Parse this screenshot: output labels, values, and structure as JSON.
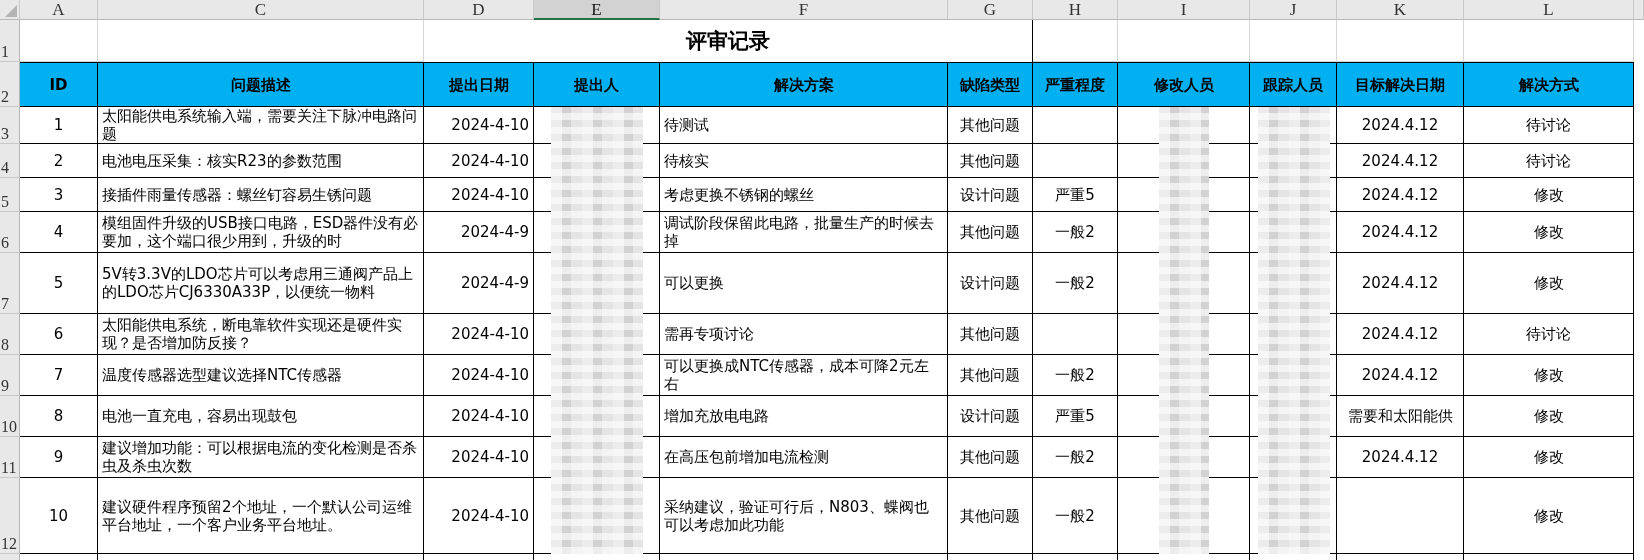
{
  "columns": [
    {
      "letter": "A",
      "selected": false
    },
    {
      "letter": "C",
      "selected": false
    },
    {
      "letter": "D",
      "selected": false
    },
    {
      "letter": "E",
      "selected": true
    },
    {
      "letter": "F",
      "selected": false
    },
    {
      "letter": "G",
      "selected": false
    },
    {
      "letter": "H",
      "selected": false
    },
    {
      "letter": "I",
      "selected": false
    },
    {
      "letter": "J",
      "selected": false
    },
    {
      "letter": "K",
      "selected": false
    },
    {
      "letter": "L",
      "selected": false
    }
  ],
  "row_numbers": [
    "1",
    "2",
    "3",
    "4",
    "5",
    "6",
    "7",
    "8",
    "9",
    "10",
    "11",
    "12"
  ],
  "title": "评审记录",
  "headers": [
    "ID",
    "问题描述",
    "提出日期",
    "提出人",
    "解决方案",
    "缺陷类型",
    "严重程度",
    "修改人员",
    "跟踪人员",
    "目标解决日期",
    "解决方式"
  ],
  "rows": [
    {
      "id": "1",
      "description": "太阳能供电系统输入端，需要关注下脉冲电路问题",
      "date": "2024-4-10",
      "solution": "待测试",
      "defect_type": "其他问题",
      "target_date": "2024.4.12",
      "resolution": "待讨论"
    },
    {
      "id": "2",
      "description": "电池电压采集：核实R23的参数范围",
      "date": "2024-4-10",
      "solution": "待核实",
      "defect_type": "其他问题",
      "target_date": "2024.4.12",
      "resolution": "待讨论"
    },
    {
      "id": "3",
      "description": "接插件雨量传感器：螺丝钉容易生锈问题",
      "date": "2024-4-10",
      "solution": "考虑更换不锈钢的螺丝",
      "defect_type": "设计问题",
      "severity": "严重5",
      "target_date": "2024.4.12",
      "resolution": "修改"
    },
    {
      "id": "4",
      "description": "模组固件升级的USB接口电路，ESD器件没有必要加，这个端口很少用到，升级的时",
      "date": "2024-4-9",
      "solution": "调试阶段保留此电路，批量生产的时候去掉",
      "defect_type": "其他问题",
      "severity": "一般2",
      "target_date": "2024.4.12",
      "resolution": "修改"
    },
    {
      "id": "5",
      "description": "5V转3.3V的LDO芯片可以考虑用三通阀产品上的LDO芯片CJ6330A33P，以便统一物料",
      "date": "2024-4-9",
      "solution": "可以更换",
      "defect_type": "设计问题",
      "severity": "一般2",
      "target_date": "2024.4.12",
      "resolution": "修改"
    },
    {
      "id": "6",
      "description": "太阳能供电系统，断电靠软件实现还是硬件实现？是否增加防反接？",
      "date": "2024-4-10",
      "solution": "需再专项讨论",
      "defect_type": "其他问题",
      "target_date": "2024.4.12",
      "resolution": "待讨论"
    },
    {
      "id": "7",
      "description": "温度传感器选型建议选择NTC传感器",
      "date": "2024-4-10",
      "solution": "可以更换成NTC传感器，成本可降2元左右",
      "defect_type": "其他问题",
      "severity": "一般2",
      "target_date": "2024.4.12",
      "resolution": "修改"
    },
    {
      "id": "8",
      "description": "电池一直充电，容易出现鼓包",
      "date": "2024-4-10",
      "solution": "增加充放电电路",
      "defect_type": "设计问题",
      "severity": "严重5",
      "target_date": "需要和太阳能供",
      "resolution": "修改"
    },
    {
      "id": "9",
      "description": "建议增加功能：可以根据电流的变化检测是否杀虫及杀虫次数",
      "date": "2024-4-10",
      "solution": "在高压包前增加电流检测",
      "defect_type": "其他问题",
      "severity": "一般2",
      "target_date": "2024.4.12",
      "resolution": "修改"
    },
    {
      "id": "10",
      "description": "建议硬件程序预留2个地址，一个默认公司运维平台地址，一个客户业务平台地址。",
      "date": "2024-4-10",
      "solution": "采纳建议，验证可行后，N803、蝶阀也可以考虑加此功能",
      "defect_type": "其他问题",
      "severity": "一般2",
      "resolution": "修改"
    }
  ]
}
